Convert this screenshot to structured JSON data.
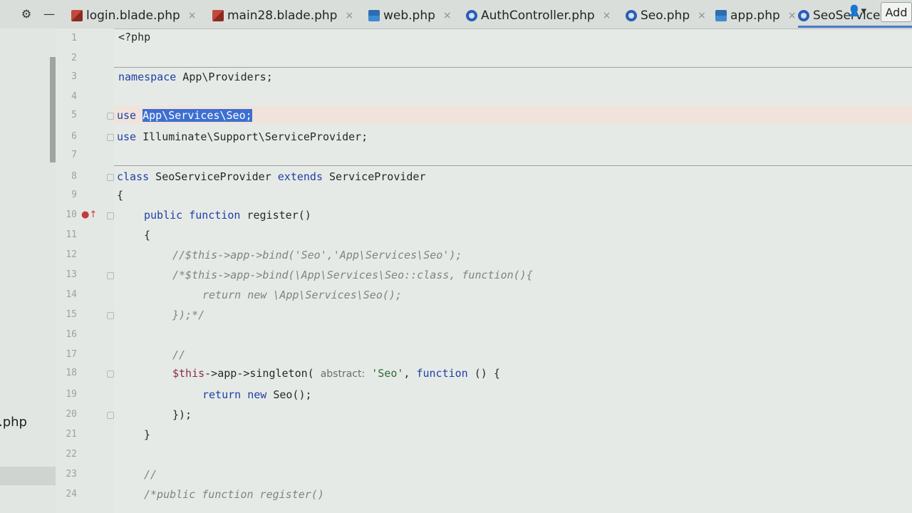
{
  "tabs": [
    {
      "label": "login.blade.php",
      "icon": "blade-file-icon",
      "close": "×"
    },
    {
      "label": "main28.blade.php",
      "icon": "blade-file-icon",
      "close": "×"
    },
    {
      "label": "web.php",
      "icon": "web-file-icon",
      "close": "×"
    },
    {
      "label": "AuthController.php",
      "icon": "php-class-icon",
      "close": "×"
    },
    {
      "label": "Seo.php",
      "icon": "php-class-icon",
      "close": "×"
    },
    {
      "label": "app.php",
      "icon": "web-file-icon",
      "close": "×"
    },
    {
      "label": "SeoServiceProvid",
      "icon": "php-class-icon",
      "active": true
    }
  ],
  "toolbar": {
    "gear": "⚙",
    "minus": "—",
    "add_label": "Add",
    "user": "👤▾"
  },
  "project_panel": {
    "file_fragment": ".php"
  },
  "gutter": {
    "line_numbers": [
      "1",
      "2",
      "3",
      "4",
      "5",
      "6",
      "7",
      "8",
      "9",
      "10",
      "11",
      "12",
      "13",
      "14",
      "15",
      "16",
      "17",
      "18",
      "19",
      "20",
      "21",
      "22",
      "23",
      "24"
    ],
    "breakpoint_marker": "●↑"
  },
  "code": {
    "l1": "<?php",
    "l3_kw": "namespace",
    "l3_rest": " App\\Providers;",
    "l5_kw": "use",
    "l5_sel": "App\\Services\\Seo;",
    "l6_kw": "use",
    "l6_rest": " Illuminate\\Support\\ServiceProvider;",
    "l8_kw1": "class",
    "l8_name": " SeoServiceProvider ",
    "l8_kw2": "extends",
    "l8_parent": " ServiceProvider",
    "l9": "{",
    "l10_kw1": "public",
    "l10_kw2": "function",
    "l10_name": " register()",
    "l11": "{",
    "l12": "//$this->app->bind('Seo','App\\Services\\Seo');",
    "l13": "/*$this->app->bind(\\App\\Services\\Seo::class, function(){",
    "l14": "return new \\App\\Services\\Seo();",
    "l15": "});*/",
    "l17": "//",
    "l18_var": "$this",
    "l18_a": "->app->singleton(",
    "l18_hint": "abstract:",
    "l18_str": "'Seo'",
    "l18_b": ", ",
    "l18_kw": "function",
    "l18_c": " () {",
    "l19_kw1": "return",
    "l19_kw2": "new",
    "l19_rest": " Seo();",
    "l20": "});",
    "l21": "}",
    "l23": "//",
    "l24": "/*public function register()"
  }
}
